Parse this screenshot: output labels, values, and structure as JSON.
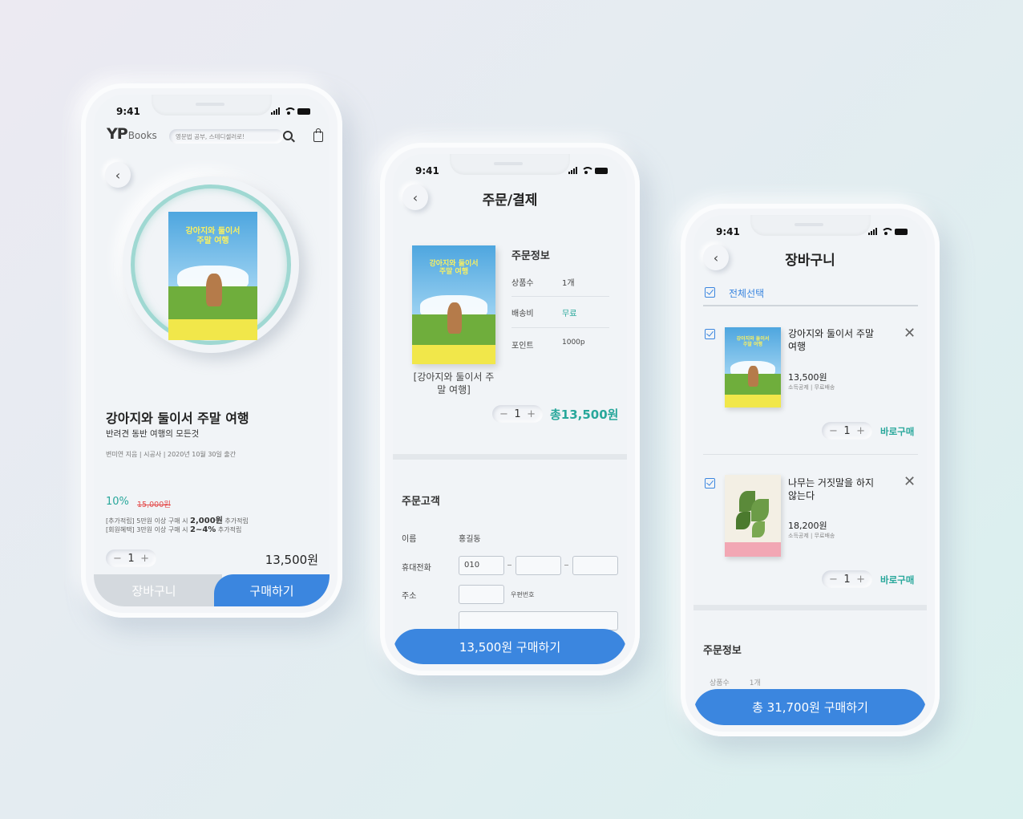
{
  "status_time": "9:41",
  "colors": {
    "accent_blue": "#3b86df",
    "teal": "#28a79b",
    "sale_red": "#e44b4b"
  },
  "detail": {
    "logo_main": "YP",
    "logo_sub": "Books",
    "search_placeholder": "영문법 공부, 스테디셀러로!",
    "book_cover_title": "강아지와 둘이서 주말 여행",
    "title": "강아지와 둘이서 주말 여행",
    "subtitle": "반려견 동반 여행의 모든것",
    "meta": "변미연 지음 | 시공사 | 2020년 10월 30일 출간",
    "discount": "10%",
    "original_price": "15,000원",
    "benefit1_prefix": "[추가적립] 5만원 이상 구매 시 ",
    "benefit1_value": "2,000원",
    "benefit1_suffix": " 추가적립",
    "benefit2_prefix": "[회원혜택] 3만원 이상 구매 시 ",
    "benefit2_value": "2~4%",
    "benefit2_suffix": " 추가적립",
    "qty": "1",
    "price": "13,500원",
    "cart_button": "장바구니",
    "buy_button": "구매하기"
  },
  "order": {
    "title": "주문/결제",
    "book_cover_title": "강아지와 둘이서 주말 여행",
    "book_caption": "[강아지와 둘이서 주말 여행]",
    "info_heading": "주문정보",
    "rows": [
      {
        "label": "상품수",
        "value": "1개"
      },
      {
        "label": "배송비",
        "value": "무료"
      },
      {
        "label": "포인트",
        "value": "1000p"
      }
    ],
    "qty": "1",
    "total": "총13,500원",
    "customer_heading": "주문고객",
    "name_label": "이름",
    "name_value": "홍길동",
    "phone_label": "휴대전화",
    "phone_prefix": "010",
    "address_label": "주소",
    "zip_label": "우편번호",
    "pay_button": "13,500원 구매하기"
  },
  "cart": {
    "title": "장바구니",
    "select_all": "전체선택",
    "items": [
      {
        "title": "강아지와 둘이서 주말 여행",
        "price": "13,500원",
        "note": "소득공제 | 무료배송",
        "qty": "1",
        "buy_now": "바로구매",
        "cover_title": "강아지와 둘이서 주말 여행"
      },
      {
        "title": "나무는 거짓말을 하지 않는다",
        "price": "18,200원",
        "note": "소득공제 | 무료배송",
        "qty": "1",
        "buy_now": "바로구매"
      }
    ],
    "info_heading": "주문정보",
    "peek_label": "상품수",
    "peek_value": "1개",
    "pay_button": "총 31,700원 구매하기"
  }
}
